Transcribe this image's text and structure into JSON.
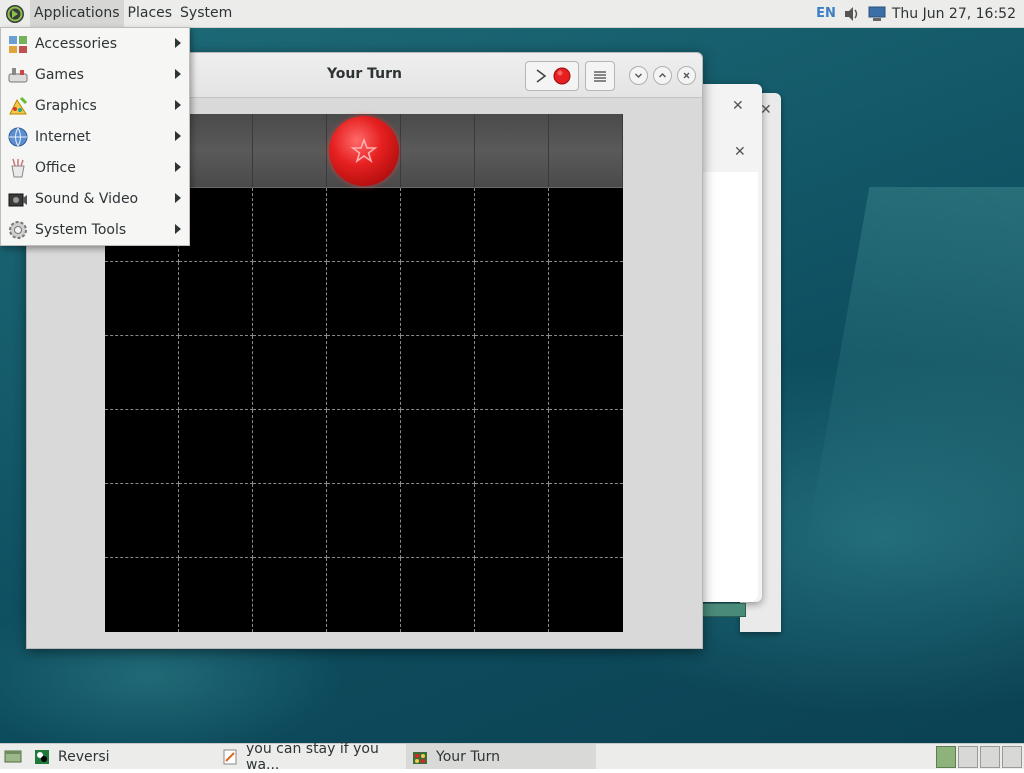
{
  "top_panel": {
    "menus": [
      "Applications",
      "Places",
      "System"
    ],
    "language": "EN",
    "clock": "Thu Jun 27, 16:52"
  },
  "applications_menu": {
    "items": [
      {
        "label": "Accessories",
        "icon": "accessories-icon"
      },
      {
        "label": "Games",
        "icon": "games-icon"
      },
      {
        "label": "Graphics",
        "icon": "graphics-icon"
      },
      {
        "label": "Internet",
        "icon": "internet-icon"
      },
      {
        "label": "Office",
        "icon": "office-icon"
      },
      {
        "label": "Sound & Video",
        "icon": "sound-video-icon"
      },
      {
        "label": "System Tools",
        "icon": "system-tools-icon"
      }
    ]
  },
  "game_window": {
    "title": "Your Turn",
    "board": {
      "columns": 7,
      "rows": 6,
      "preview_column": 4,
      "preview_piece_color": "#e62020"
    }
  },
  "taskbar": {
    "tasks": [
      {
        "label": "Reversi",
        "active": false
      },
      {
        "label": "you can stay if you wa...",
        "active": false
      },
      {
        "label": "Your Turn",
        "active": true
      }
    ]
  },
  "colors": {
    "accent_blue": "#3b7fc4",
    "piece_red": "#e62020",
    "board_black": "#000000"
  }
}
